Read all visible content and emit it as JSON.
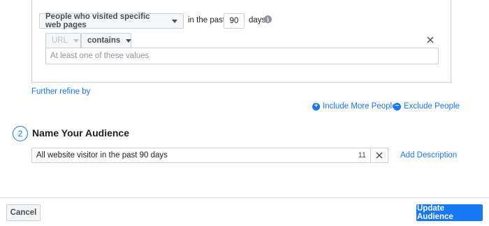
{
  "rule": {
    "audience_type": "People who visited specific web pages",
    "in_the_past_label": "in the past",
    "days_value": "90",
    "days_label": "days",
    "filter": {
      "field": "URL",
      "operator": "contains",
      "values_placeholder": "At least one of these values"
    }
  },
  "refine": {
    "further_refine_label": "Further refine by",
    "include_more_label": "Include More People",
    "exclude_label": "Exclude People"
  },
  "name_section": {
    "step_number": "2",
    "title": "Name Your Audience",
    "audience_name": "All website visitor in the past 90 days",
    "char_count": "11",
    "add_description_label": "Add Description"
  },
  "footer": {
    "cancel_label": "Cancel",
    "update_label": "Update Audience"
  },
  "colors": {
    "accent": "#1877f2",
    "border": "#ccd0d5",
    "text": "#1c1e21"
  },
  "icons": [
    "caret-down-icon",
    "info-icon",
    "close-icon",
    "plus-circle-icon",
    "minus-circle-icon"
  ]
}
